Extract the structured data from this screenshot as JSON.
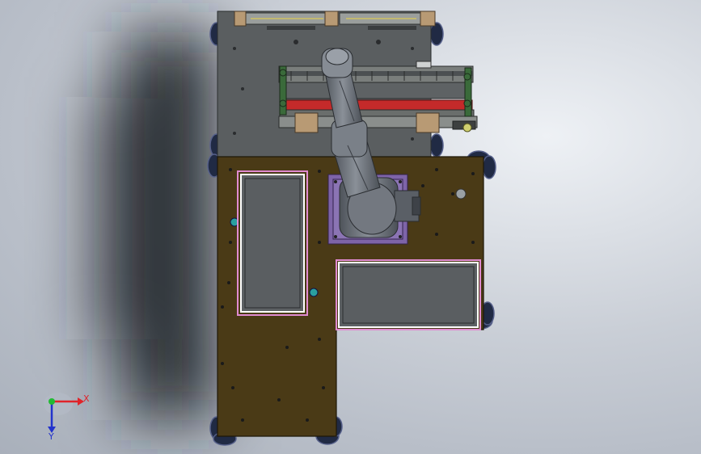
{
  "viewport": {
    "background_colors": {
      "center": "#eef1f5",
      "edge": "#a9b0bb",
      "shadow": "#1f2228"
    }
  },
  "model": {
    "colors": {
      "upper_plate": "#5a5e60",
      "lower_plate": "#4a3a16",
      "tray_fill": "#5c6063",
      "tray_border": "#ffffff",
      "tray_rim": "#e08ad0",
      "robot_body": "#6b7077",
      "robot_base_pad": "#7e64a8",
      "conveyor_belt": "#c42a2a",
      "bracket_tan": "#b89a74",
      "caster": "#202a44"
    }
  },
  "triad": {
    "x_label": "X",
    "y_label": "Y",
    "x_color": "#e0242a",
    "y_color": "#2233cc",
    "origin_color": "#22bb33"
  }
}
